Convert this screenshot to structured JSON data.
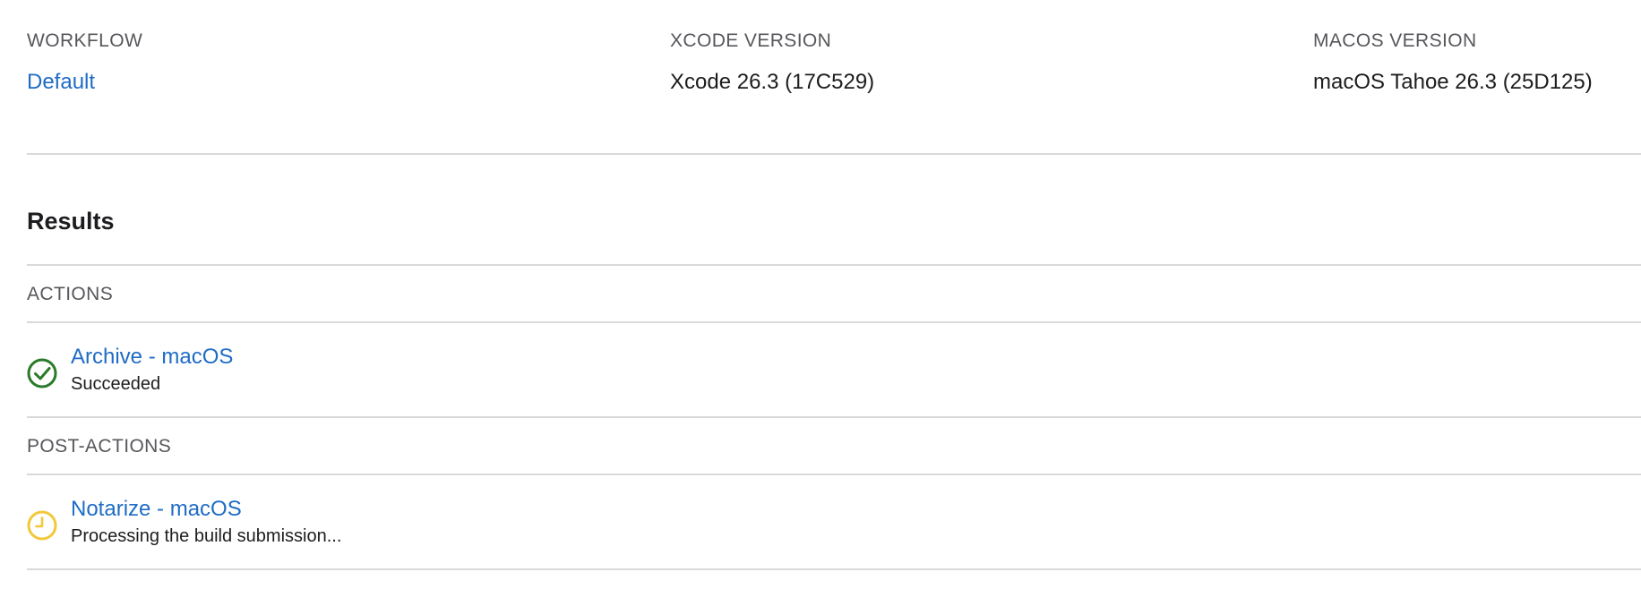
{
  "summary": {
    "workflow": {
      "label": "WORKFLOW",
      "value": "Default"
    },
    "xcode": {
      "label": "XCODE VERSION",
      "value": "Xcode 26.3 (17C529)"
    },
    "macos": {
      "label": "MACOS VERSION",
      "value": "macOS Tahoe 26.3 (25D125)"
    }
  },
  "results": {
    "title": "Results",
    "actions": {
      "label": "ACTIONS",
      "items": [
        {
          "name": "Archive - macOS",
          "status": "Succeeded",
          "icon": "success-check-icon",
          "icon_color": "#2a7a2a"
        }
      ]
    },
    "post_actions": {
      "label": "POST-ACTIONS",
      "items": [
        {
          "name": "Notarize - macOS",
          "status": "Processing the build submission...",
          "icon": "pending-clock-icon",
          "icon_color": "#f2c83a"
        }
      ]
    }
  },
  "colors": {
    "link": "#1f6cc5",
    "divider": "#d9d9dc",
    "secondary_text": "#57575c",
    "success": "#2a7a2a",
    "pending": "#f2c83a"
  }
}
